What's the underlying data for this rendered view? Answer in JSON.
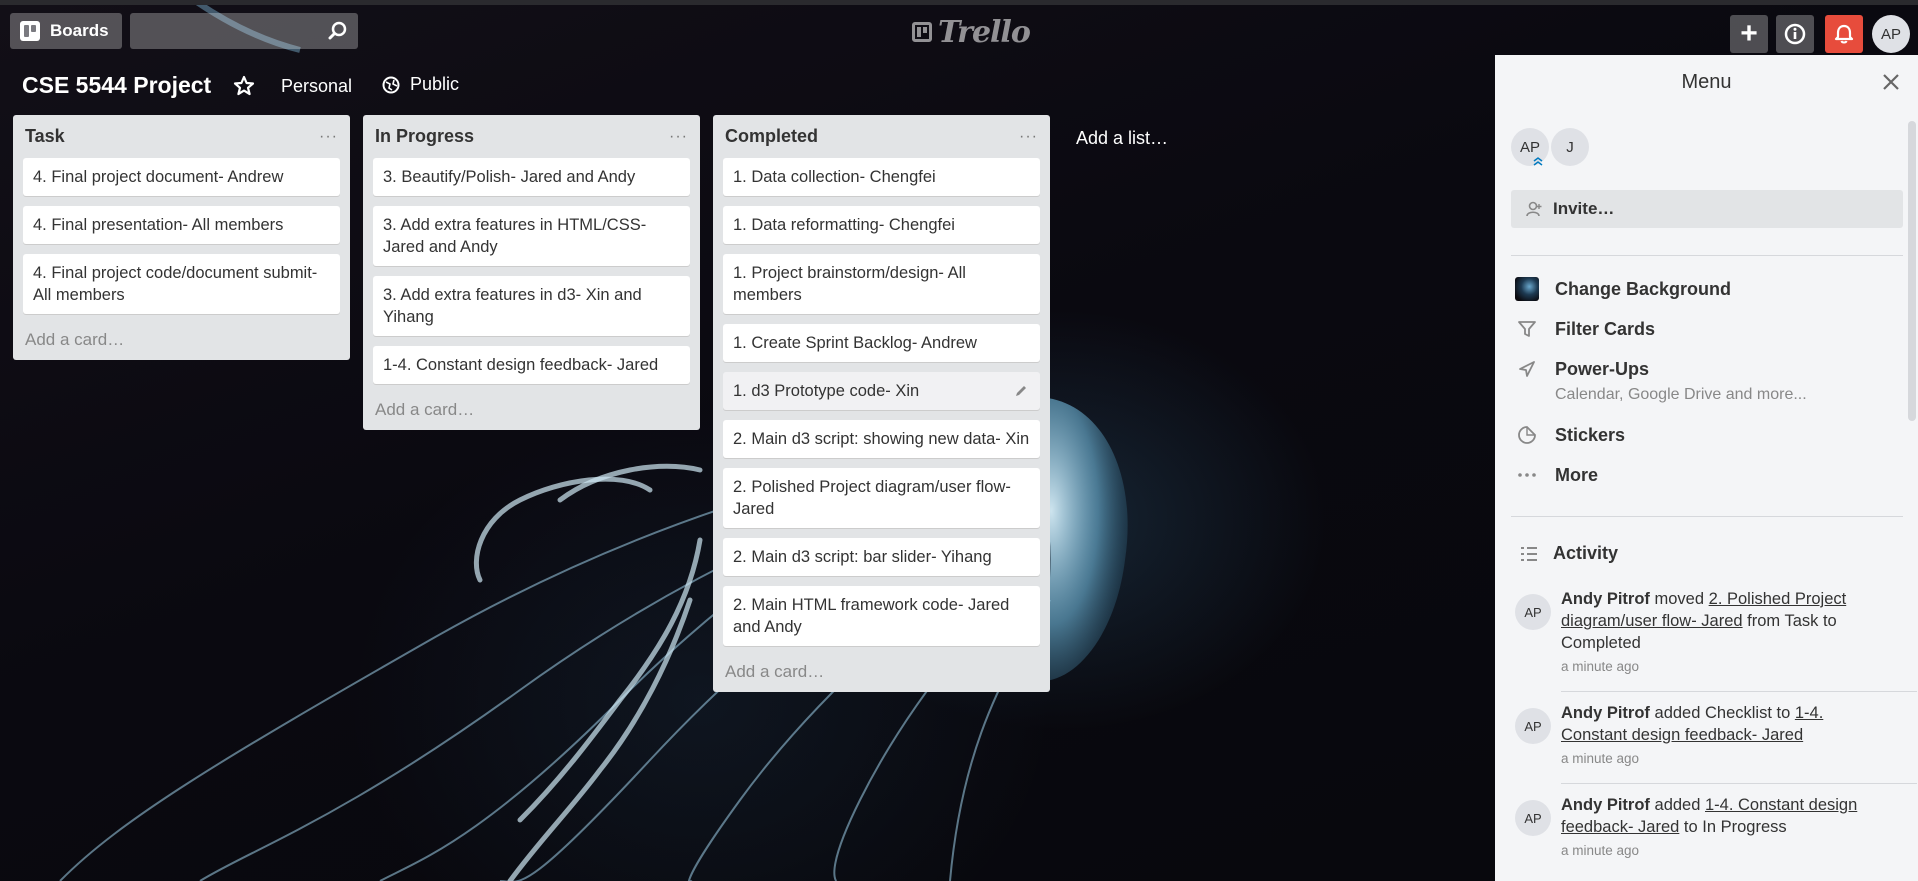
{
  "header": {
    "boards_label": "Boards",
    "search_value": "",
    "logo_text": "Trello",
    "add_label": "+",
    "avatar_initials": "AP"
  },
  "board": {
    "title": "CSE 5544 Project",
    "visibility_team": "Personal",
    "visibility": "Public",
    "add_list_label": "Add a list…"
  },
  "lists": [
    {
      "title": "Task",
      "menu": "···",
      "cards": [
        "4. Final project document- Andrew",
        "4. Final presentation- All members",
        "4. Final project code/document submit- All members"
      ],
      "add_card": "Add a card…"
    },
    {
      "title": "In Progress",
      "menu": "···",
      "cards": [
        "3. Beautify/Polish- Jared and Andy",
        "3. Add extra features in HTML/CSS- Jared and Andy",
        "3. Add extra features in d3- Xin and Yihang",
        "1-4. Constant design feedback- Jared"
      ],
      "add_card": "Add a card…"
    },
    {
      "title": "Completed",
      "menu": "···",
      "cards": [
        "1. Data collection- Chengfei",
        "1. Data reformatting- Chengfei",
        "1. Project brainstorm/design- All members",
        "1. Create Sprint Backlog- Andrew",
        "1. d3 Prototype code- Xin",
        "2. Main d3 script: showing new data- Xin",
        "2. Polished Project diagram/user flow- Jared",
        "2. Main d3 script: bar slider- Yihang",
        "2. Main HTML framework code- Jared and Andy"
      ],
      "add_card": "Add a card…"
    }
  ],
  "menu": {
    "title": "Menu",
    "members": [
      "AP",
      "J"
    ],
    "invite_label": "Invite…",
    "items": [
      {
        "label": "Change Background",
        "icon": "background-swatch-icon"
      },
      {
        "label": "Filter Cards",
        "icon": "filter-icon"
      },
      {
        "label": "Power-Ups",
        "sub": "Calendar, Google Drive and more...",
        "icon": "rocket-icon"
      },
      {
        "label": "Stickers",
        "icon": "sticker-icon"
      },
      {
        "label": "More",
        "icon": "more-dots-icon"
      }
    ],
    "activity_label": "Activity",
    "activity": [
      {
        "avatar": "AP",
        "user": "Andy Pitrof",
        "action": "moved",
        "link": "2. Polished Project diagram/user flow- Jared",
        "rest": "from Task to Completed",
        "time": "a minute ago"
      },
      {
        "avatar": "AP",
        "user": "Andy Pitrof",
        "action": "added Checklist to",
        "link": "1-4. Constant design feedback- Jared",
        "rest": "",
        "time": "a minute ago"
      },
      {
        "avatar": "AP",
        "user": "Andy Pitrof",
        "action": "added",
        "link": "1-4. Constant design feedback- Jared",
        "rest": "to In Progress",
        "time": "a minute ago"
      }
    ]
  },
  "colors": {
    "list_bg": "#e2e4e6",
    "menu_bg": "#f4f5f7",
    "notification": "#e74c3c"
  }
}
